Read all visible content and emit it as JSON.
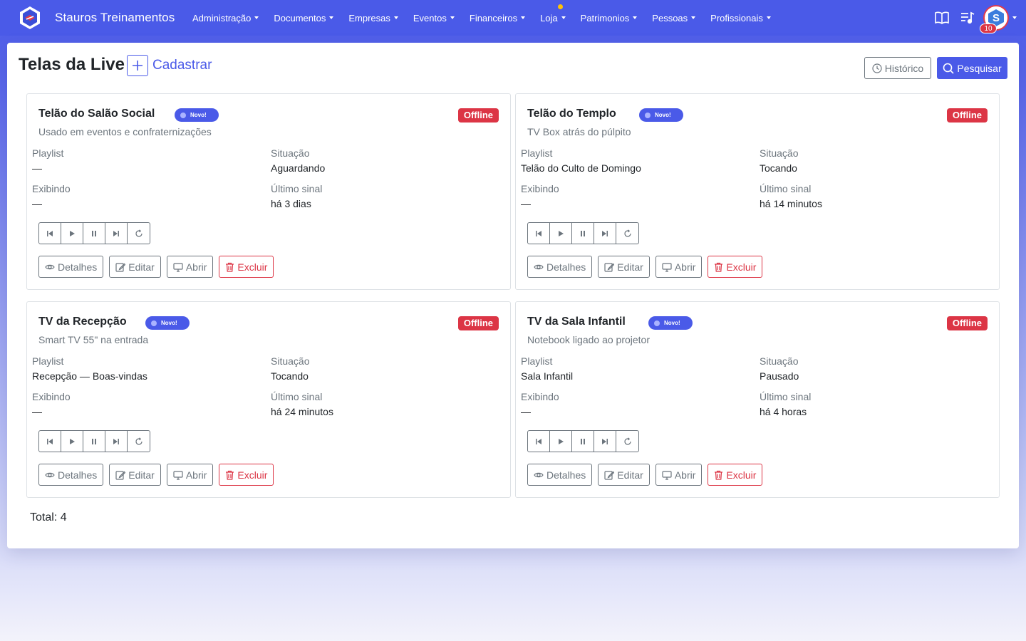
{
  "navbar": {
    "brand": "Stauros Treinamentos",
    "menu": [
      {
        "label": "Administração"
      },
      {
        "label": "Documentos"
      },
      {
        "label": "Empresas"
      },
      {
        "label": "Eventos"
      },
      {
        "label": "Financeiros"
      },
      {
        "label": "Loja",
        "notification_dot": true
      },
      {
        "label": "Patrimonios"
      },
      {
        "label": "Pessoas"
      },
      {
        "label": "Profissionais"
      }
    ],
    "right_icons": [
      "book-icon",
      "playlist-icon"
    ],
    "notification_count": "10",
    "accent_color": "#4a5ae8"
  },
  "page": {
    "title": "Telas da Live",
    "add_label": "Cadastrar",
    "history_label": "Histórico",
    "search_label": "Pesquisar",
    "total_label": "Total: 4"
  },
  "labels": {
    "playlist": "Playlist",
    "situacao": "Situação",
    "exibindo": "Exibindo",
    "ultimo_sinal": "Último sinal",
    "novo": "Novo!",
    "detalhes": "Detalhes",
    "editar": "Editar",
    "abrir": "Abrir",
    "excluir": "Excluir"
  },
  "cards": [
    {
      "title": "Telão do Salão Social",
      "status": "Offline",
      "description": "Usado em eventos e confraternizações",
      "playlist": "—",
      "situacao": "Aguardando",
      "exibindo": "—",
      "ultimo_sinal": "há 3 dias"
    },
    {
      "title": "Telão do Templo",
      "status": "Offline",
      "description": "TV Box atrás do púlpito",
      "playlist": "Telão do Culto de Domingo",
      "situacao": "Tocando",
      "exibindo": "—",
      "ultimo_sinal": "há 14 minutos"
    },
    {
      "title": "TV da Recepção",
      "status": "Offline",
      "description": "Smart TV 55\" na entrada",
      "playlist": "Recepção — Boas-vindas",
      "situacao": "Tocando",
      "exibindo": "—",
      "ultimo_sinal": "há 24 minutos"
    },
    {
      "title": "TV da Sala Infantil",
      "status": "Offline",
      "description": "Notebook ligado ao projetor",
      "playlist": "Sala Infantil",
      "situacao": "Pausado",
      "exibindo": "—",
      "ultimo_sinal": "há 4 horas"
    }
  ]
}
